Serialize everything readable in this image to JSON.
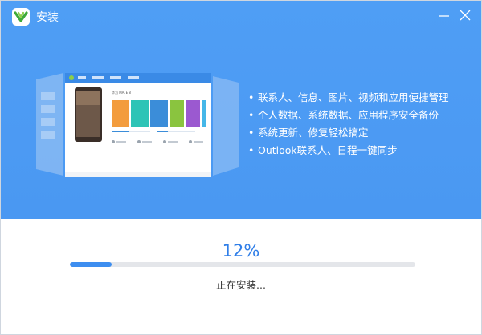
{
  "window": {
    "title": "安装"
  },
  "icons": {
    "logo": "app-logo-icon",
    "minimize": "minimize-icon",
    "close": "close-icon"
  },
  "colors": {
    "header_blue": "#4a98f2",
    "accent_blue": "#3d8ef0",
    "percent_text": "#2f7ee8",
    "track": "#e4e6ea"
  },
  "features": [
    "联系人、信息、图片、视频和应用便捷管理",
    "个人数据、系统数据、应用程序安全备份",
    "系统更新、修复轻松搞定",
    "Outlook联系人、日程一键同步"
  ],
  "preview": {
    "device_name": "华为 MATE 8",
    "color_tiles": [
      "#f39c3d",
      "#2ec4b6",
      "#3b8dd9",
      "#8ac43f",
      "#9b59d0",
      "#45b7e8"
    ]
  },
  "progress": {
    "percent_label": "12%",
    "value": 0.12,
    "status": "正在安装..."
  }
}
